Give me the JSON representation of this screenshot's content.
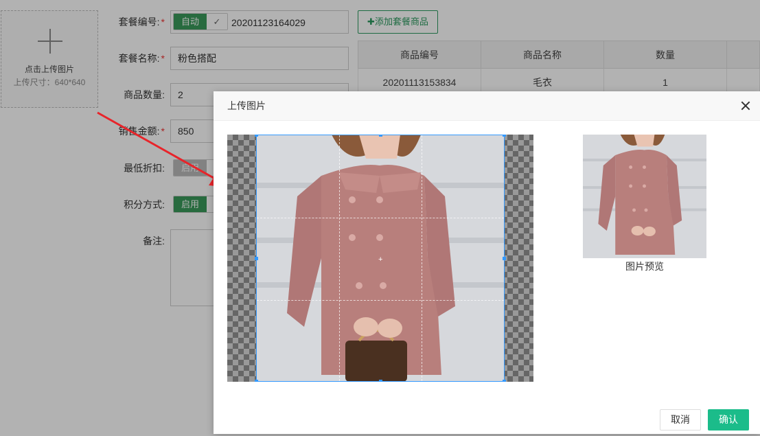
{
  "upload": {
    "title": "点击上传图片",
    "size_hint": "上传尺寸：640*640"
  },
  "form": {
    "code": {
      "label": "套餐编号:",
      "required": "*",
      "toggle_on": "自动",
      "value": "20201123164029"
    },
    "name": {
      "label": "套餐名称:",
      "required": "*",
      "value": "粉色搭配"
    },
    "quantity": {
      "label": "商品数量:",
      "value": "2"
    },
    "amount": {
      "label": "销售金额:",
      "required": "*",
      "value": "850"
    },
    "discount": {
      "label": "最低折扣:",
      "toggle_on": "启用"
    },
    "points": {
      "label": "积分方式:",
      "toggle_on": "启用"
    },
    "remark": {
      "label": "备注:"
    }
  },
  "add_button": "✚添加套餐商品",
  "table": {
    "headers": [
      "商品编号",
      "商品名称",
      "数量"
    ],
    "rows": [
      [
        "20201113153834",
        "毛衣",
        "1"
      ]
    ]
  },
  "modal": {
    "title": "上传图片",
    "preview_label": "图片预览",
    "cancel": "取消",
    "confirm": "确认"
  },
  "colors": {
    "accent": "#1bbc8a",
    "green": "#3a9a5b",
    "crop_border": "#3399ff",
    "arrow": "#e8242a"
  }
}
